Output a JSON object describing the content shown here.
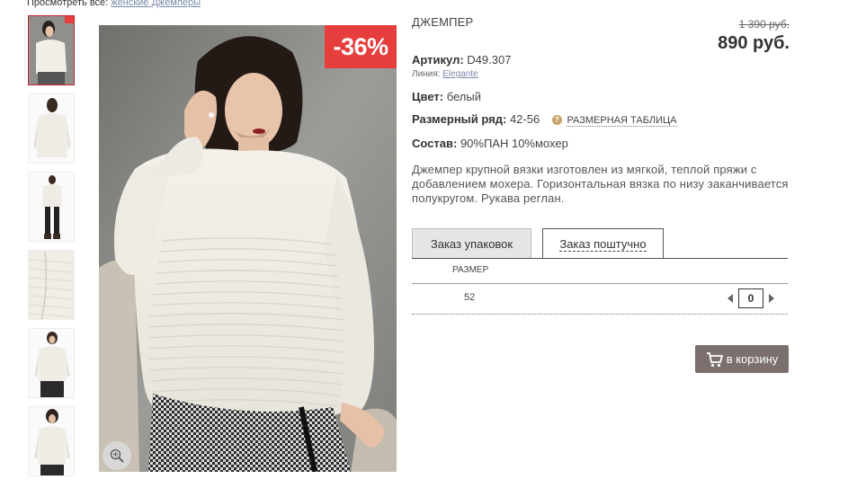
{
  "breadcrumb": {
    "prefix": "Просмотреть все:",
    "link": "женские Джемперы"
  },
  "product": {
    "badge": "-36%",
    "name": "ДЖЕМПЕР",
    "old_price": "1 390 руб.",
    "new_price": "890 руб.",
    "article_label": "Артикул:",
    "article_value": "D49.307",
    "line_label": "Линия:",
    "line_value": "Elegante",
    "color_label": "Цвет:",
    "color_value": "белый",
    "size_range_label": "Размерный ряд:",
    "size_range_value": "42-56",
    "size_table_link": "РАЗМЕРНАЯ ТАБЛИЦА",
    "size_table_icon": "?",
    "composition_label": "Состав:",
    "composition_value": "90%ПАН 10%мохер",
    "description": "Джемпер крупной вязки изготовлен из мягкой, теплой пряжи с добавлением мохера. Горизонтальная вязка по низу заканчивается полукругом. Рукава реглан."
  },
  "tabs": [
    {
      "label": "Заказ упаковок",
      "active": false
    },
    {
      "label": "Заказ поштучно",
      "active": true
    }
  ],
  "order_table": {
    "header_size": "РАЗМЕР",
    "rows": [
      {
        "size": "52",
        "qty": "0"
      }
    ]
  },
  "cart_button": {
    "label": "в корзину",
    "icon": "cart-icon"
  },
  "colors": {
    "accent_red": "#e63d3d",
    "cart_button": "#7b706d",
    "link": "#7a8aa8"
  },
  "icons": [
    "zoom-icon",
    "cart-icon",
    "help-icon",
    "arrow-left-icon",
    "arrow-right-icon"
  ]
}
